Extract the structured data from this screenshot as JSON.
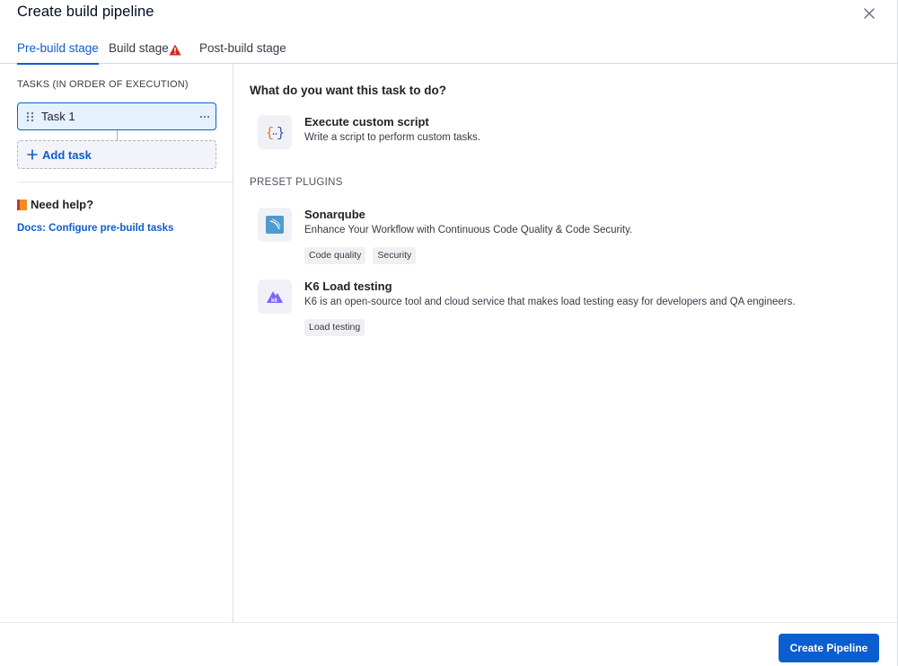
{
  "header": {
    "title": "Create build pipeline",
    "close_icon": "close-icon"
  },
  "tabs": [
    {
      "label": "Pre-build stage",
      "active": true
    },
    {
      "label": "Build stage",
      "active": false,
      "warning": true,
      "warning_icon": "warning-triangle-icon"
    },
    {
      "label": "Post-build stage",
      "active": false
    }
  ],
  "left": {
    "section_label": "TASKS (IN ORDER OF EXECUTION)",
    "tasks": [
      {
        "name": "Task 1",
        "selected": true
      }
    ],
    "add_task_label": "Add task",
    "help_label": "Need help?",
    "doc_link": "Docs: Configure pre-build tasks"
  },
  "right": {
    "question": "What do you want this task to do?",
    "custom": {
      "title": "Execute custom script",
      "description": "Write a script to perform custom tasks.",
      "icon": "curly-braces-script-icon"
    },
    "preset_label": "PRESET PLUGINS",
    "plugins": [
      {
        "title": "Sonarqube",
        "description": "Enhance Your Workflow with Continuous Code Quality & Code Security.",
        "tags": [
          "Code quality",
          "Security"
        ],
        "icon": "sonarqube-icon"
      },
      {
        "title": "K6 Load testing",
        "description": "K6 is an open-source tool and cloud service that makes load testing easy for developers and QA engineers.",
        "tags": [
          "Load testing"
        ],
        "icon": "k6-icon"
      }
    ]
  },
  "footer": {
    "create_label": "Create Pipeline"
  },
  "colors": {
    "accent": "#0b5ed0",
    "warning": "#da291d",
    "selected_bg": "#e5f2fe",
    "k6": "#7d64ff",
    "sonar": "#4e9bcd"
  }
}
